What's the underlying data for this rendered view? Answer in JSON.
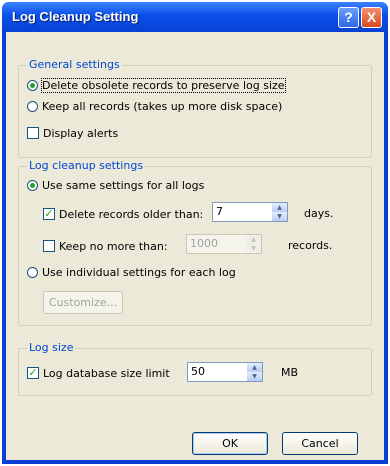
{
  "window": {
    "title": "Log Cleanup Setting",
    "help_glyph": "?",
    "close_glyph": "X"
  },
  "general": {
    "legend": "General settings",
    "options": [
      {
        "label": "Delete obsolete records to preserve log size",
        "selected": true
      },
      {
        "label": "Keep all records (takes up more disk space)",
        "selected": false
      }
    ],
    "display_alerts": {
      "label": "Display alerts",
      "checked": false
    }
  },
  "cleanup": {
    "legend": "Log cleanup settings",
    "same_settings": {
      "label": "Use same settings for all logs",
      "selected": true
    },
    "delete_older": {
      "label": "Delete records older than:",
      "checked": true,
      "value": "7",
      "unit": "days."
    },
    "keep_no_more": {
      "label": "Keep no more than:",
      "checked": false,
      "value": "1000",
      "unit": "records."
    },
    "individual": {
      "label": "Use individual settings for each log",
      "selected": false
    },
    "customize_label": "Customize..."
  },
  "logsize": {
    "legend": "Log size",
    "limit": {
      "label": "Log database size limit",
      "checked": true,
      "value": "50",
      "unit": "MB"
    }
  },
  "buttons": {
    "ok": "OK",
    "cancel": "Cancel"
  },
  "colors": {
    "titlebar": "#0a4ee8",
    "legend_text": "#0046d5",
    "dialog_bg": "#ece9d8",
    "check_mark": "#21a121"
  },
  "icons": {
    "check": "✓",
    "spin_up": "▲",
    "spin_down": "▼"
  }
}
